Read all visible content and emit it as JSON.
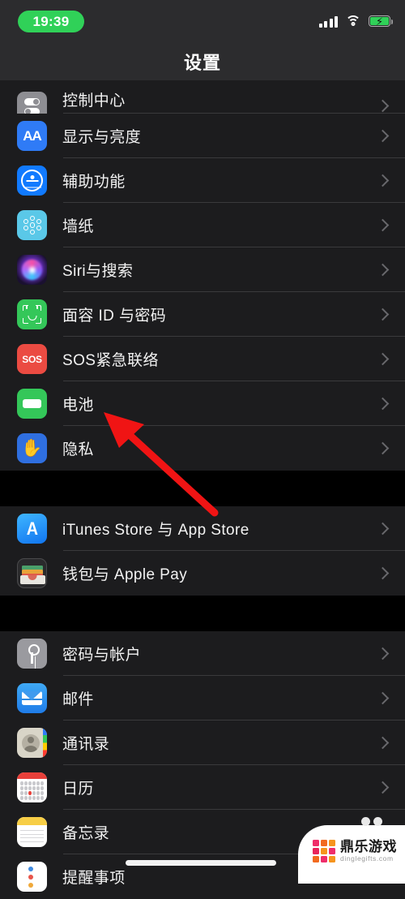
{
  "status_bar": {
    "time": "19:39",
    "recording_indicator_color": "#30d158",
    "signal_icon": "cellular-bars-icon",
    "wifi_icon": "wifi-icon",
    "battery_icon": "battery-charging-icon",
    "battery_color": "#30d158"
  },
  "nav": {
    "title": "设置"
  },
  "groups": [
    {
      "rows": [
        {
          "label": "控制中心",
          "icon": "control-center-icon",
          "clipped": true
        },
        {
          "label": "显示与亮度",
          "icon": "display-brightness-icon"
        },
        {
          "label": "辅助功能",
          "icon": "accessibility-icon"
        },
        {
          "label": "墙纸",
          "icon": "wallpaper-icon"
        },
        {
          "label": "Siri与搜索",
          "icon": "siri-icon"
        },
        {
          "label": "面容 ID 与密码",
          "icon": "face-id-icon"
        },
        {
          "label": "SOS紧急联络",
          "icon": "emergency-sos-icon"
        },
        {
          "label": "电池",
          "icon": "battery-icon"
        },
        {
          "label": "隐私",
          "icon": "privacy-icon"
        }
      ]
    },
    {
      "rows": [
        {
          "label": "iTunes Store 与 App Store",
          "icon": "app-store-icon"
        },
        {
          "label": "钱包与 Apple Pay",
          "icon": "wallet-icon"
        }
      ]
    },
    {
      "rows": [
        {
          "label": "密码与帐户",
          "icon": "passwords-accounts-icon"
        },
        {
          "label": "邮件",
          "icon": "mail-icon"
        },
        {
          "label": "通讯录",
          "icon": "contacts-icon"
        },
        {
          "label": "日历",
          "icon": "calendar-icon"
        },
        {
          "label": "备忘录",
          "icon": "notes-icon"
        },
        {
          "label": "提醒事项",
          "icon": "reminders-icon"
        }
      ]
    }
  ],
  "annotation": {
    "arrow_color": "#f01414",
    "points_to": "电池"
  },
  "watermark": {
    "title": "鼎乐游戏",
    "url": "dinglegifts.com",
    "logo_colors": [
      "#ef2d6a",
      "#f26a1f",
      "#f6941d",
      "#e8245b",
      "#f6941d",
      "#ef2d6a",
      "#f26a1f",
      "#ef2d6a",
      "#f6941d"
    ]
  },
  "icons": {
    "sos_text": "SOS",
    "display_text": "AA",
    "app_store_text": "A",
    "hand_glyph": "✋"
  }
}
